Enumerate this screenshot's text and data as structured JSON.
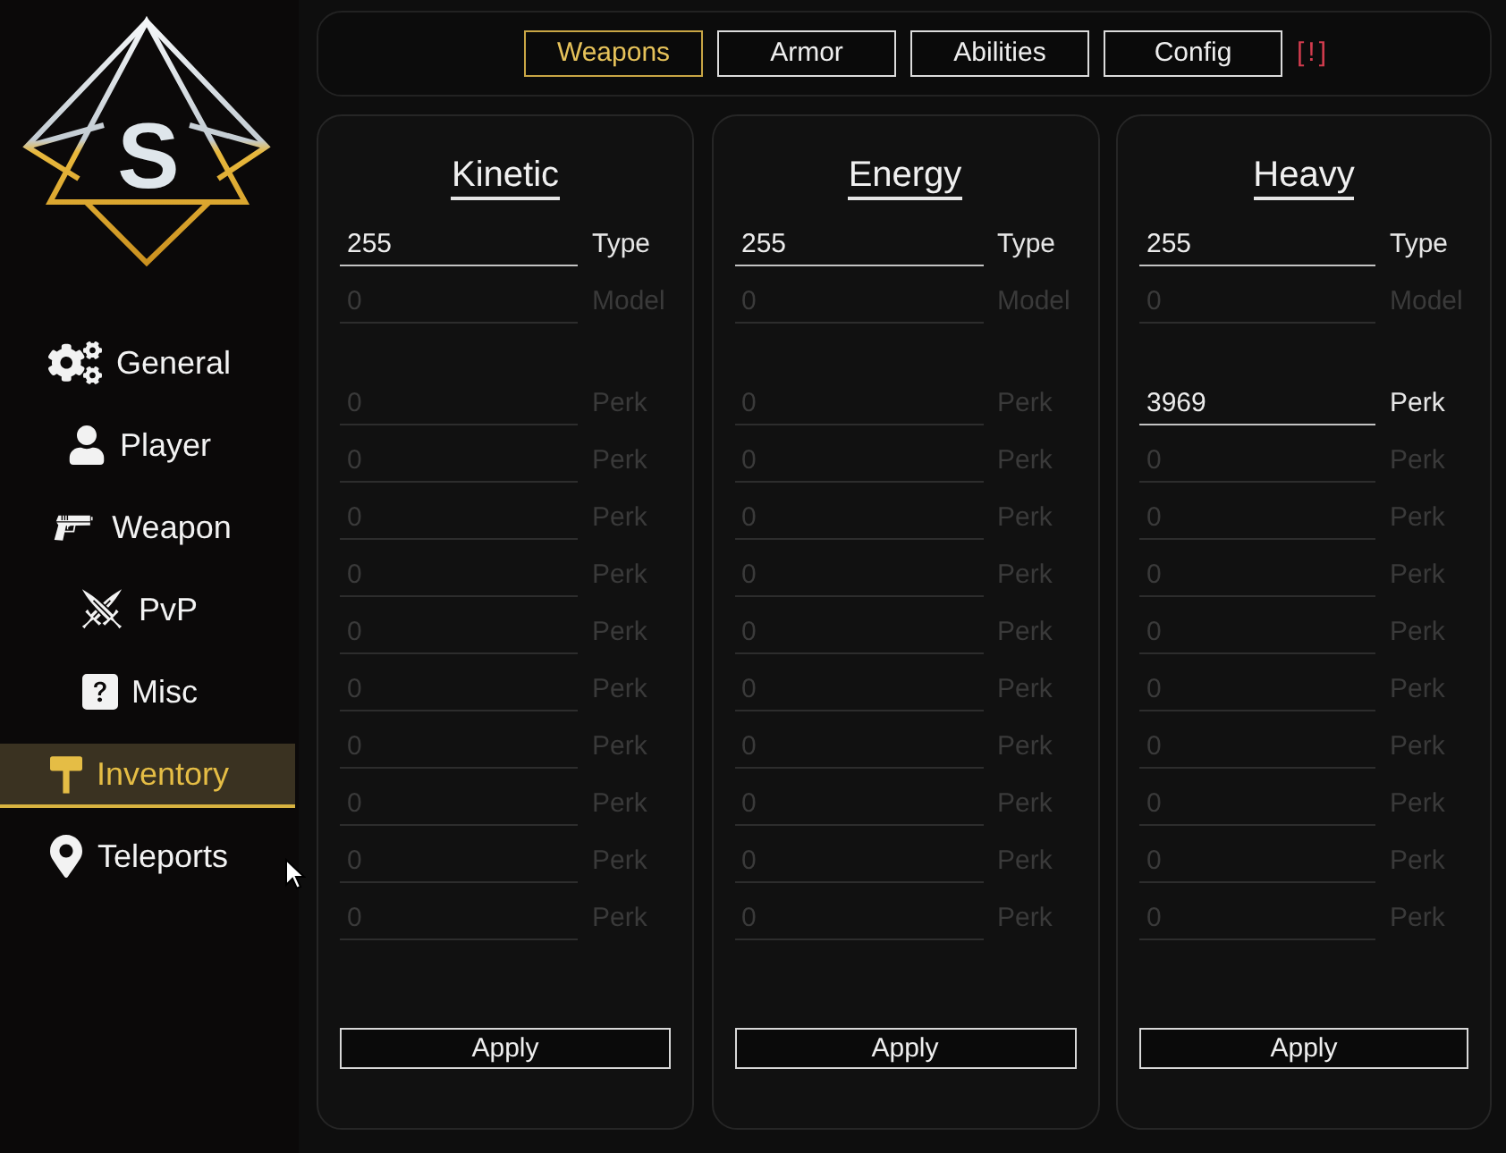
{
  "logo": {
    "letter": "S"
  },
  "sidebar": {
    "items": [
      {
        "label": "General",
        "selected": false
      },
      {
        "label": "Player",
        "selected": false
      },
      {
        "label": "Weapon",
        "selected": false
      },
      {
        "label": "PvP",
        "selected": false
      },
      {
        "label": "Misc",
        "selected": false
      },
      {
        "label": "Inventory",
        "selected": true
      },
      {
        "label": "Teleports",
        "selected": false
      }
    ]
  },
  "tabs": [
    {
      "label": "Weapons",
      "selected": true
    },
    {
      "label": "Armor",
      "selected": false
    },
    {
      "label": "Abilities",
      "selected": false
    },
    {
      "label": "Config",
      "selected": false
    }
  ],
  "warning": "[!]",
  "columns": [
    {
      "title": "Kinetic",
      "fields": [
        {
          "label": "Type",
          "value": "255"
        },
        {
          "label": "Model",
          "placeholder": "0"
        }
      ],
      "perks": [
        {
          "label": "Perk",
          "placeholder": "0"
        },
        {
          "label": "Perk",
          "placeholder": "0"
        },
        {
          "label": "Perk",
          "placeholder": "0"
        },
        {
          "label": "Perk",
          "placeholder": "0"
        },
        {
          "label": "Perk",
          "placeholder": "0"
        },
        {
          "label": "Perk",
          "placeholder": "0"
        },
        {
          "label": "Perk",
          "placeholder": "0"
        },
        {
          "label": "Perk",
          "placeholder": "0"
        },
        {
          "label": "Perk",
          "placeholder": "0"
        },
        {
          "label": "Perk",
          "placeholder": "0"
        }
      ],
      "button": "Apply"
    },
    {
      "title": "Energy",
      "fields": [
        {
          "label": "Type",
          "value": "255"
        },
        {
          "label": "Model",
          "placeholder": "0"
        }
      ],
      "perks": [
        {
          "label": "Perk",
          "placeholder": "0"
        },
        {
          "label": "Perk",
          "placeholder": "0"
        },
        {
          "label": "Perk",
          "placeholder": "0"
        },
        {
          "label": "Perk",
          "placeholder": "0"
        },
        {
          "label": "Perk",
          "placeholder": "0"
        },
        {
          "label": "Perk",
          "placeholder": "0"
        },
        {
          "label": "Perk",
          "placeholder": "0"
        },
        {
          "label": "Perk",
          "placeholder": "0"
        },
        {
          "label": "Perk",
          "placeholder": "0"
        },
        {
          "label": "Perk",
          "placeholder": "0"
        }
      ],
      "button": "Apply"
    },
    {
      "title": "Heavy",
      "fields": [
        {
          "label": "Type",
          "value": "255"
        },
        {
          "label": "Model",
          "placeholder": "0"
        }
      ],
      "perks": [
        {
          "label": "Perk",
          "value": "3969"
        },
        {
          "label": "Perk",
          "placeholder": "0"
        },
        {
          "label": "Perk",
          "placeholder": "0"
        },
        {
          "label": "Perk",
          "placeholder": "0"
        },
        {
          "label": "Perk",
          "placeholder": "0"
        },
        {
          "label": "Perk",
          "placeholder": "0"
        },
        {
          "label": "Perk",
          "placeholder": "0"
        },
        {
          "label": "Perk",
          "placeholder": "0"
        },
        {
          "label": "Perk",
          "placeholder": "0"
        },
        {
          "label": "Perk",
          "placeholder": "0"
        }
      ],
      "button": "Apply"
    }
  ]
}
